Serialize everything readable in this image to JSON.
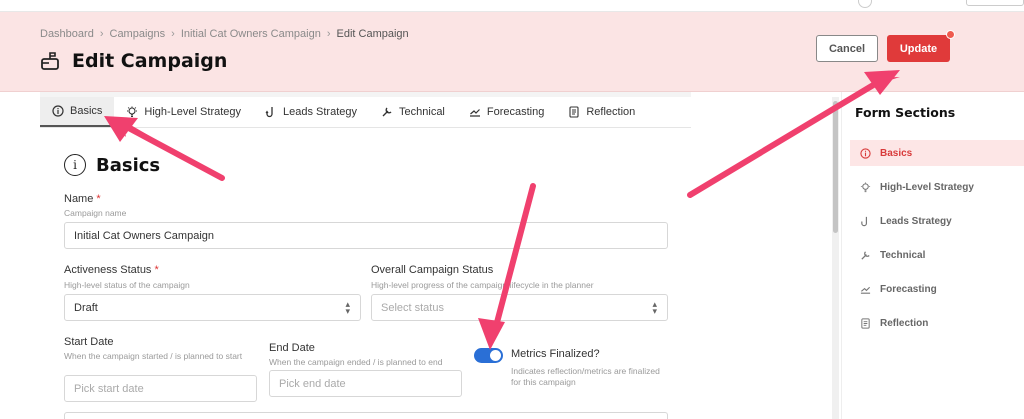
{
  "breadcrumb": [
    "Dashboard",
    "Campaigns",
    "Initial Cat Owners Campaign",
    "Edit Campaign"
  ],
  "page": {
    "title": "Edit Campaign"
  },
  "actions": {
    "cancel": "Cancel",
    "update": "Update"
  },
  "tabs": [
    {
      "label": "Basics",
      "icon": "info-icon",
      "active": true
    },
    {
      "label": "High-Level Strategy",
      "icon": "lightbulb-icon"
    },
    {
      "label": "Leads Strategy",
      "icon": "hook-icon"
    },
    {
      "label": "Technical",
      "icon": "wrench-icon"
    },
    {
      "label": "Forecasting",
      "icon": "trend-icon"
    },
    {
      "label": "Reflection",
      "icon": "document-icon"
    }
  ],
  "section": {
    "title": "Basics"
  },
  "form": {
    "name": {
      "label": "Name",
      "required": "*",
      "hint": "Campaign name",
      "value": "Initial Cat Owners Campaign"
    },
    "activeness": {
      "label": "Activeness Status",
      "required": "*",
      "hint": "High-level status of the campaign",
      "value": "Draft"
    },
    "overall": {
      "label": "Overall Campaign Status",
      "hint": "High-level progress of the campaign lifecycle in the planner",
      "placeholder": "Select status"
    },
    "start_date": {
      "label": "Start Date",
      "hint": "When the campaign started / is planned to start",
      "placeholder": "Pick start date"
    },
    "end_date": {
      "label": "End Date",
      "hint": "When the campaign ended / is planned to end",
      "placeholder": "Pick end date"
    },
    "metrics": {
      "label": "Metrics Finalized?",
      "hint": "Indicates reflection/metrics are finalized for this campaign",
      "checked": true
    }
  },
  "sidebar": {
    "title": "Form Sections",
    "items": [
      {
        "label": "Basics",
        "icon": "info-icon",
        "active": true
      },
      {
        "label": "High-Level Strategy",
        "icon": "lightbulb-icon"
      },
      {
        "label": "Leads Strategy",
        "icon": "hook-icon"
      },
      {
        "label": "Technical",
        "icon": "wrench-icon"
      },
      {
        "label": "Forecasting",
        "icon": "trend-icon"
      },
      {
        "label": "Reflection",
        "icon": "document-icon"
      }
    ]
  },
  "colors": {
    "accent": "#e03a3a",
    "header_bg": "#fbe4e4",
    "toggle": "#2a6fd6",
    "annotation_arrow": "#f0406e"
  }
}
